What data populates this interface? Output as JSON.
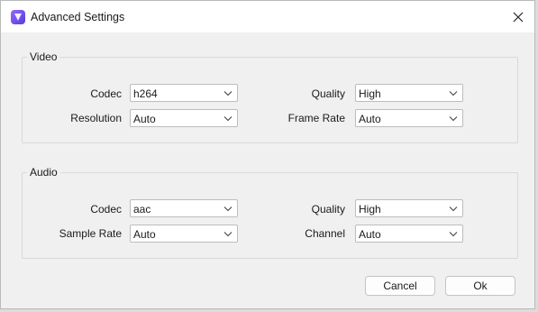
{
  "window": {
    "title": "Advanced Settings",
    "close_icon": "close-icon"
  },
  "video": {
    "legend": "Video",
    "codec": {
      "label": "Codec",
      "value": "h264"
    },
    "resolution": {
      "label": "Resolution",
      "value": "Auto"
    },
    "quality": {
      "label": "Quality",
      "value": "High"
    },
    "frame_rate": {
      "label": "Frame Rate",
      "value": "Auto"
    }
  },
  "audio": {
    "legend": "Audio",
    "codec": {
      "label": "Codec",
      "value": "aac"
    },
    "sample_rate": {
      "label": "Sample Rate",
      "value": "Auto"
    },
    "quality": {
      "label": "Quality",
      "value": "High"
    },
    "channel": {
      "label": "Channel",
      "value": "Auto"
    }
  },
  "buttons": {
    "cancel": "Cancel",
    "ok": "Ok"
  }
}
